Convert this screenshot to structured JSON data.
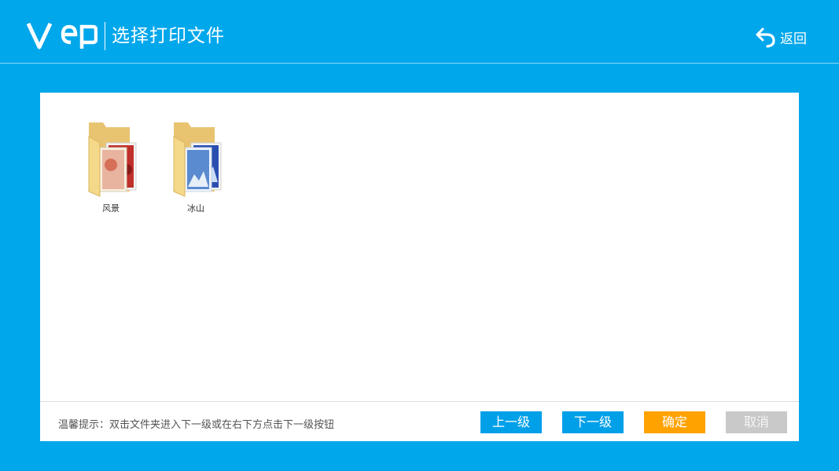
{
  "header": {
    "title": "选择打印文件",
    "back_label": "返回",
    "logo_icon": "vep-logo"
  },
  "folders": [
    {
      "name": "风景",
      "thumb_color": "#c0302a"
    },
    {
      "name": "冰山",
      "thumb_color": "#2a4fb0"
    }
  ],
  "footer": {
    "hint": "温馨提示：双击文件夹进入下一级或在右下方点击下一级按钮",
    "btn_up": "上一级",
    "btn_down": "下一级",
    "btn_ok": "确定",
    "btn_cancel": "取消"
  },
  "colors": {
    "background": "#00a7eb",
    "primary_button": "#00a0e9",
    "confirm_button": "#ffa200",
    "cancel_button": "#c9c9c9"
  }
}
